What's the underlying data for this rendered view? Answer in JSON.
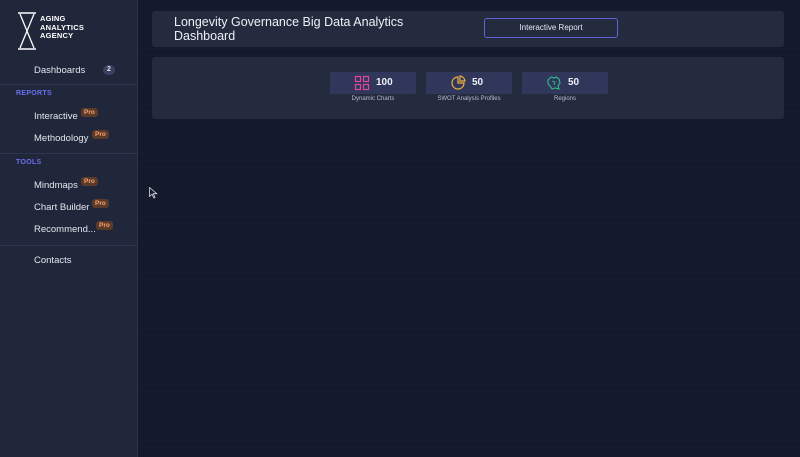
{
  "sidebar": {
    "logo": {
      "line1": "AGING",
      "line2": "ANALYTICS",
      "line3": "AGENCY",
      "icon": "hourglass-x-icon"
    },
    "dashboards": {
      "label": "Dashboards",
      "count": "2"
    },
    "reports_section": "REPORTS",
    "interactive": {
      "label": "Interactive",
      "badge": "Pro"
    },
    "methodology": {
      "label": "Methodology",
      "badge": "Pro"
    },
    "tools_section": "TOOLS",
    "mindmaps": {
      "label": "Mindmaps",
      "badge": "Pro"
    },
    "chart_builder": {
      "label": "Chart Builder",
      "badge": "Pro"
    },
    "recommend": {
      "label": "Recommend...",
      "badge": "Pro"
    },
    "contacts": {
      "label": "Contacts"
    }
  },
  "header": {
    "title": "Longevity Governance Big Data Analytics Dashboard",
    "report_button": "Interactive Report"
  },
  "stats": [
    {
      "value": "100",
      "label": "Dynamic Charts",
      "icon": "grid-icon",
      "color": "#e0479e"
    },
    {
      "value": "50",
      "label": "SWOT Analysis Profiles",
      "icon": "pie-chart-icon",
      "color": "#f0b040"
    },
    {
      "value": "50",
      "label": "Regions",
      "icon": "map-icon",
      "color": "#2fbf8f"
    }
  ],
  "colors": {
    "accent": "#6c6ff0",
    "pro_badge": "#ffa26b",
    "background": "#141a2b",
    "card": "#252b3f"
  }
}
